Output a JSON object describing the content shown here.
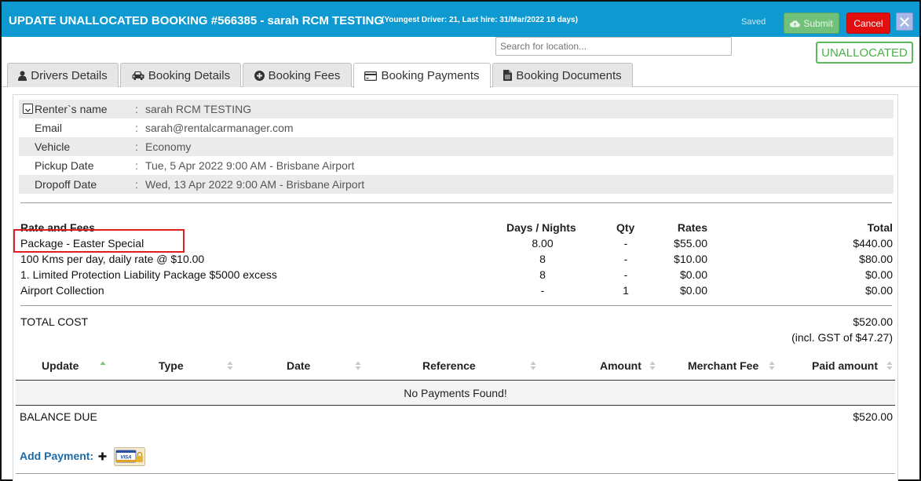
{
  "header": {
    "title": "UPDATE UNALLOCATED BOOKING #566385  - sarah RCM TESTING",
    "subtitle": "(Youngest Driver: 21, Last hire: 31/Mar/2022 18 days)",
    "saved_label": "Saved",
    "submit_label": "Submit",
    "cancel_label": "Cancel",
    "accent": "#0e9ad0"
  },
  "search": {
    "placeholder": "Search for location..."
  },
  "status_badge": "UNALLOCATED",
  "tabs": [
    {
      "label": "Drivers Details",
      "icon": "user-icon"
    },
    {
      "label": "Booking Details",
      "icon": "car-icon"
    },
    {
      "label": "Booking Fees",
      "icon": "plus-circle-icon"
    },
    {
      "label": "Booking Payments",
      "icon": "credit-card-icon",
      "active": true
    },
    {
      "label": "Booking Documents",
      "icon": "document-icon"
    }
  ],
  "renter": {
    "rows": [
      {
        "label": "Renter`s name",
        "value": "sarah RCM TESTING"
      },
      {
        "label": "Email",
        "value": "sarah@rentalcarmanager.com"
      },
      {
        "label": "Vehicle",
        "value": "Economy"
      },
      {
        "label": "Pickup Date",
        "value": "Tue, 5 Apr 2022 9:00 AM - Brisbane Airport"
      },
      {
        "label": "Dropoff Date",
        "value": "Wed, 13 Apr 2022 9:00 AM - Brisbane Airport"
      }
    ],
    "separator": ":"
  },
  "fees": {
    "headers": {
      "name": "Rate and Fees",
      "days": "Days / Nights",
      "qty": "Qty",
      "rates": "Rates",
      "total": "Total"
    },
    "rows": [
      {
        "name": "Package - Easter Special",
        "days": "8.00",
        "qty": "-",
        "rate": "$55.00",
        "total": "$440.00"
      },
      {
        "name": "100 Kms per day, daily rate @ $10.00",
        "days": "8",
        "qty": "-",
        "rate": "$10.00",
        "total": "$80.00"
      },
      {
        "name": "1. Limited Protection Liability Package $5000 excess",
        "days": "8",
        "qty": "-",
        "rate": "$0.00",
        "total": "$0.00"
      },
      {
        "name": "Airport Collection",
        "days": "-",
        "qty": "1",
        "rate": "$0.00",
        "total": "$0.00"
      }
    ],
    "total_label": "TOTAL COST",
    "total_value": "$520.00",
    "gst_note": "(incl. GST of $47.27)"
  },
  "payments": {
    "headers": [
      "Update",
      "Type",
      "Date",
      "Reference",
      "Amount",
      "Merchant Fee",
      "Paid amount"
    ],
    "empty_message": "No Payments Found!",
    "balance_label": "BALANCE DUE",
    "balance_value": "$520.00",
    "add_label": "Add Payment:",
    "card_text": "VISA"
  }
}
